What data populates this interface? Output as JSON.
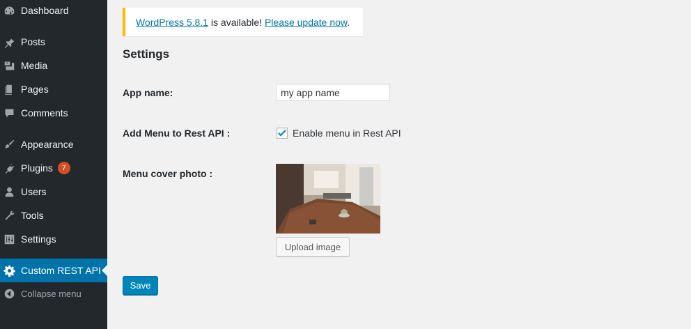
{
  "sidebar": {
    "items": [
      {
        "label": "Dashboard",
        "icon": "dashboard-icon"
      },
      {
        "label": "Posts",
        "icon": "pin-icon"
      },
      {
        "label": "Media",
        "icon": "media-icon"
      },
      {
        "label": "Pages",
        "icon": "pages-icon"
      },
      {
        "label": "Comments",
        "icon": "comment-icon"
      },
      {
        "label": "Appearance",
        "icon": "brush-icon"
      },
      {
        "label": "Plugins",
        "icon": "plug-icon",
        "badge": "7"
      },
      {
        "label": "Users",
        "icon": "user-icon"
      },
      {
        "label": "Tools",
        "icon": "wrench-icon"
      },
      {
        "label": "Settings",
        "icon": "sliders-icon"
      },
      {
        "label": "Custom REST API",
        "icon": "gear-icon",
        "active": true
      },
      {
        "label": "Collapse menu",
        "icon": "collapse-arrow-icon"
      }
    ],
    "accent_color": "#0073aa",
    "badge_color": "#d54e21"
  },
  "notice": {
    "version_link": "WordPress 5.8.1",
    "middle_text": " is available! ",
    "update_link": "Please update now",
    "end_text": ".",
    "border_color": "#ffb900"
  },
  "settings": {
    "heading": "Settings",
    "app_name_label": "App name:",
    "app_name_value": "my app name",
    "menu_label": "Add Menu to Rest API :",
    "menu_checkbox_label": "Enable menu in Rest API",
    "menu_checkbox_checked": true,
    "cover_label": "Menu cover photo :",
    "upload_label": "Upload image",
    "save_label": "Save"
  }
}
